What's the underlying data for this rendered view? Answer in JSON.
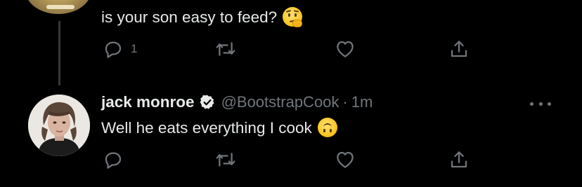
{
  "previous_tweet": {
    "text": "is your son easy to feed?",
    "emoji": "thinking-face",
    "actions": {
      "reply_count": "1",
      "retweet_count": "",
      "like_count": ""
    }
  },
  "reply_tweet": {
    "author": {
      "name": "jack monroe",
      "handle": "@BootstrapCook",
      "verified": true
    },
    "separator": "·",
    "time": "1m",
    "text": "Well he eats everything I cook",
    "emoji": "upside-down-face",
    "actions": {
      "reply_count": "",
      "retweet_count": "",
      "like_count": ""
    }
  },
  "colors": {
    "background": "#000000",
    "text_primary": "#e7e9ea",
    "text_secondary": "#71767b",
    "thread_line": "#333639"
  },
  "icons": [
    "reply-icon",
    "retweet-icon",
    "like-icon",
    "share-icon",
    "verified-badge-icon",
    "more-options-icon"
  ]
}
